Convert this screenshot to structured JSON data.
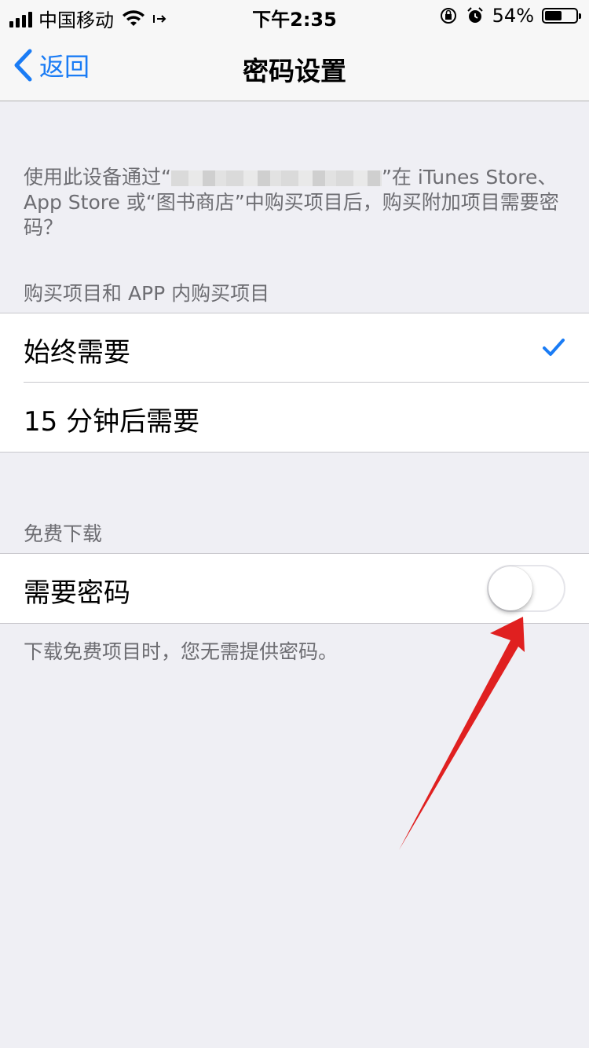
{
  "status_bar": {
    "carrier": "中国移动",
    "time": "下午2:35",
    "battery_percent": "54%",
    "battery_level": 0.54,
    "icons": [
      "signal-icon",
      "wifi-icon",
      "location-icon",
      "rotation-lock-icon",
      "alarm-icon",
      "battery-icon"
    ]
  },
  "nav": {
    "back_label": "返回",
    "title": "密码设置"
  },
  "description": {
    "before": "使用此设备通过“",
    "after": "”在 iTunes Store、App Store 或“图书商店”中购买项目后，购买附加项目需要密码？"
  },
  "purchases": {
    "header": "购买项目和 APP 内购买项目",
    "options": [
      {
        "label": "始终需要",
        "selected": true
      },
      {
        "label": "15 分钟后需要",
        "selected": false
      }
    ]
  },
  "free_downloads": {
    "header": "免费下载",
    "require_password_label": "需要密码",
    "require_password_on": false,
    "footer": "下载免费项目时，您无需提供密码。"
  },
  "colors": {
    "accent": "#1a7cf5",
    "background": "#efeff4",
    "annotation_arrow": "#e02020"
  }
}
